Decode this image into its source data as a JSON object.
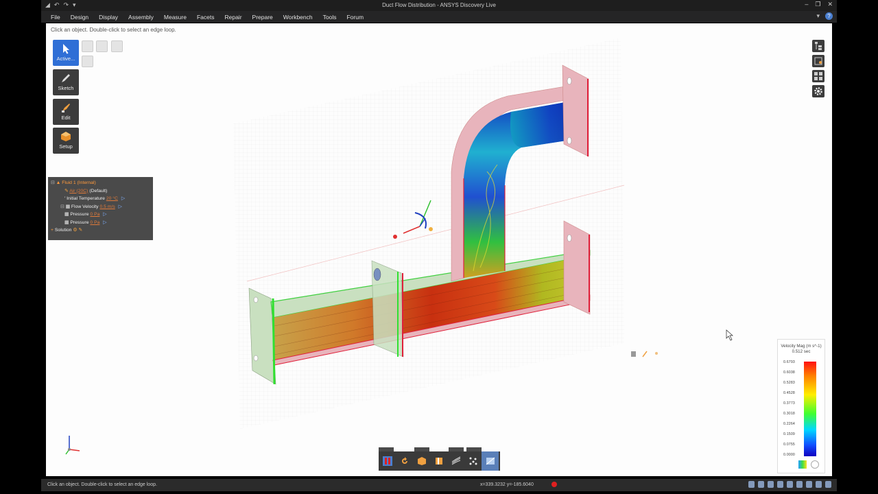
{
  "window": {
    "title": "Duct Flow Distribution - ANSYS Discovery Live"
  },
  "menu": [
    "File",
    "Design",
    "Display",
    "Assembly",
    "Measure",
    "Facets",
    "Repair",
    "Prepare",
    "Workbench",
    "Tools",
    "Forum"
  ],
  "viewport": {
    "hint": "Click an object. Double-click to select an edge loop."
  },
  "tools": {
    "active": "Active...",
    "sketch": "Sketch",
    "edit": "Edit",
    "setup": "Setup"
  },
  "tree": {
    "fluid": "Fluid 1 (Internal)",
    "material": "Air (20C)",
    "material_suffix": "(Default)",
    "init_temp_label": "Initial Temperature",
    "init_temp_value": "20 °C",
    "flow_vel_label": "Flow Velocity",
    "flow_vel_value": "0.5 m/s",
    "pressure1_label": "Pressure",
    "pressure1_value": "0 Pa",
    "pressure2_label": "Pressure",
    "pressure2_value": "0 Pa",
    "solution": "Solution"
  },
  "legend": {
    "title": "Velocity Mag (m s^-1)",
    "subtitle": "0.512 sec",
    "ticks": [
      "0.6793",
      "0.6038",
      "0.5283",
      "0.4528",
      "0.3773",
      "0.3018",
      "0.2264",
      "0.1509",
      "0.0755",
      "0.0000"
    ]
  },
  "status": {
    "text": "Click an object. Double-click to select an edge loop.",
    "coords": "x=339.3232  y=-185.6040"
  },
  "colors": {
    "accent": "#2f6fd6",
    "duct_body": "#e8b4bc",
    "inlet_green": "#c9e0c0",
    "edge_red": "#e0203a",
    "edge_green": "#30e030"
  }
}
